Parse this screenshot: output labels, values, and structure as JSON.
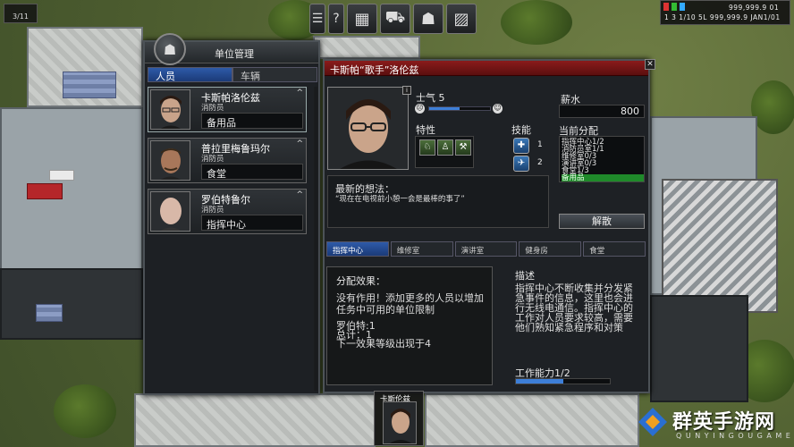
{
  "hud": {
    "top_left": "3/11",
    "top_right_line1": "999,999.9 01",
    "top_right_line2": "1    3  1/10  5L  999,999.9    JAN1/01"
  },
  "toolbar": {
    "buttons": [
      {
        "name": "menu-button",
        "glyph": "☰"
      },
      {
        "name": "help-button",
        "glyph": "?"
      },
      {
        "name": "build-button",
        "glyph": "▦"
      },
      {
        "name": "vehicles-button",
        "glyph": "⛟"
      },
      {
        "name": "staff-button",
        "glyph": "☗"
      },
      {
        "name": "reports-button",
        "glyph": "▨"
      }
    ]
  },
  "unit_panel": {
    "title": "单位管理",
    "tabs": [
      "人员",
      "车辆"
    ],
    "staff": [
      {
        "name": "卡斯帕洛伦兹",
        "role": "消防员",
        "assignment": "备用品"
      },
      {
        "name": "普拉里梅鲁玛尔",
        "role": "消防员",
        "assignment": "食堂"
      },
      {
        "name": "罗伯特鲁尔",
        "role": "消防员",
        "assignment": "指挥中心"
      }
    ]
  },
  "detail": {
    "title": "卡斯帕“歌手”洛伦兹",
    "info_icon": "i",
    "morale_label": "士气 5",
    "morale_value": 0.5,
    "traits_label": "特性",
    "skills_label": "技能",
    "skills": [
      {
        "level": "1"
      },
      {
        "level": "2"
      }
    ],
    "salary_label": "薪水",
    "salary_value": "800",
    "current_assign_label": "当前分配",
    "assignments": [
      {
        "text": "指挥中心1/2",
        "highlight": false
      },
      {
        "text": "消防员室1/1",
        "highlight": false
      },
      {
        "text": "维修室0/3",
        "highlight": false
      },
      {
        "text": "演讲室0/3",
        "highlight": false
      },
      {
        "text": "食堂1/3",
        "highlight": false
      },
      {
        "text": "备用品",
        "highlight": true
      }
    ],
    "thought_title": "最新的想法：",
    "thought_text": "“现在在电视前小憩一会是最棒的事了”",
    "dismiss_label": "解散",
    "room_tabs": [
      "指挥中心",
      "维修室",
      "演讲室",
      "健身房",
      "食堂"
    ],
    "effect_title": "分配效果：",
    "effect_desc": "没有作用！添加更多的人员以增加任务中可用的单位限制",
    "effect_stats": [
      "罗伯特:1",
      "总计：1",
      "下一效果等级出现于4"
    ],
    "desc_title": "描述",
    "desc_text": "指挥中心不断收集并分发紧急事件的信息，这里也会进行无线电通信。指挥中心的工作对人员要求较高，需要他们熟知紧急程序和对策",
    "capacity_label": "工作能力1/2",
    "capacity_value": 0.5
  },
  "bottom_person": {
    "name": "卡斯伦兹"
  },
  "watermark": {
    "text": "群英手游网",
    "url": "Q U N Y I N G O U G A M E"
  },
  "colors": {
    "accent_blue": "#2e5aa8",
    "title_red": "#8a1b1b",
    "highlight_green": "#1f8a2a"
  }
}
